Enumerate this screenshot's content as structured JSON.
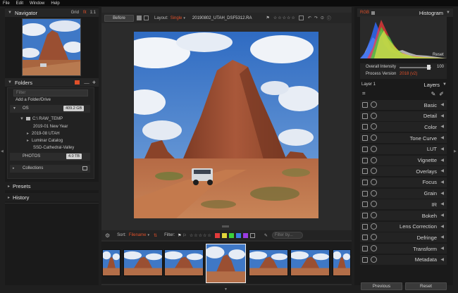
{
  "menu": [
    "File",
    "Edit",
    "Window",
    "Help"
  ],
  "navigator": {
    "title": "Navigator",
    "grid": "Grid",
    "fit": "fit",
    "one": "1:1"
  },
  "folders": {
    "title": "Folders",
    "filter_placeholder": "Filter",
    "add_folder": "Add a Folder/Drive",
    "os_label": "OS",
    "os_size": "409.2 GB",
    "tree": [
      "C:\\ RAW_TEMP",
      "2019-01 New Year",
      "2019-08 UTAH",
      "Luminar Catalog",
      "SSD-Cathedral-Valley"
    ],
    "photos_label": "PHOTOS",
    "photos_size": "4.0 TB",
    "collections": "Collections"
  },
  "presets": "Presets",
  "history": "History",
  "toolbar": {
    "before": "Before",
    "layout_label": "Layout:",
    "layout_value": "Single",
    "filename": "20190802_UTAH_DSF5312.RA"
  },
  "filterbar": {
    "sort_label": "Sort:",
    "sort_value": "Filename",
    "filter_label": "Filter:",
    "filter_by": "Filter by..."
  },
  "colors": {
    "accent": "#e0502a",
    "labels": [
      "#e23b3b",
      "#e2d53b",
      "#3bd13b",
      "#3b7ae2",
      "#9a3be2",
      "#dddddd"
    ]
  },
  "histogram": {
    "title": "Histogram",
    "mode": "RGB",
    "reset": "Reset"
  },
  "intensity": {
    "label": "Overall Intensity",
    "value": "100",
    "process_label": "Process Version",
    "process_value": "2018 (v2)"
  },
  "layers": {
    "layer": "Layer 1",
    "title": "Layers"
  },
  "adjustments": [
    "Basic",
    "Detail",
    "Color",
    "Tone Curve",
    "LUT",
    "Vignette",
    "Overlays",
    "Focus",
    "Grain",
    "IR",
    "Bokeh",
    "Lens Correction",
    "Defringe",
    "Transform",
    "Metadata"
  ],
  "bottom": {
    "previous": "Previous",
    "reset": "Reset"
  }
}
